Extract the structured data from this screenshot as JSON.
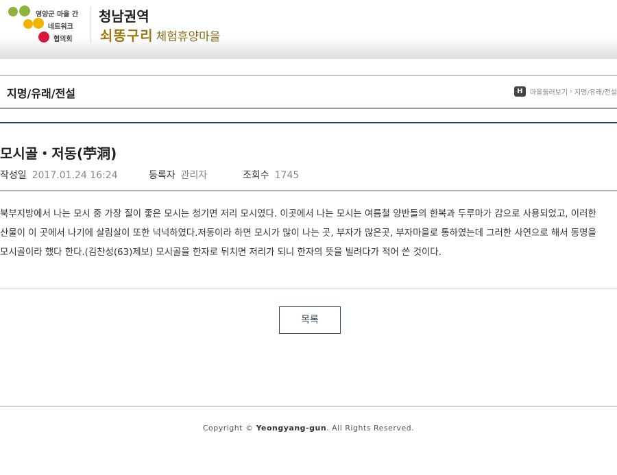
{
  "header": {
    "logo_lines": [
      "영양군 마을 간",
      "네트워크",
      "협의회"
    ],
    "site_line1": "청남권역",
    "brand": "쇠똥구리",
    "brand_sub": "체험휴양마을",
    "colors": {
      "logo_green": "#8db43e",
      "logo_yellow": "#f0b400",
      "logo_red": "#d6183a",
      "brand_gold": "#9a7a10"
    }
  },
  "titlebar": {
    "title": "지명/유래/전설",
    "breadcrumb_home": "H",
    "breadcrumb": [
      "마을둘러보기",
      "지명/유래/전설"
    ]
  },
  "article": {
    "title": "모시골・저동(苧洞)",
    "meta": {
      "date_label": "작성일",
      "date": "2017.01.24 16:24",
      "author_label": "등록자",
      "author": "관리자",
      "views_label": "조회수",
      "views": "1745"
    },
    "body": "북부지방에서 나는 모시 중 가장 질이 좋은 모시는 청기면 저리 모시였다. 이곳에서 나는 모시는 여름철 양반들의 한복과 두루마가 감으로 사용되었고, 이러한 산물이 이 곳에서 나기에 살림살이 또한 넉넉하였다.저동이라 하면 모시가 많이 나는 곳, 부자가 많은곳, 부자마을로 통하였는데 그러한 사연으로 해서 동명을 모시골이라 했다 한다.(김찬성(63)제보) 모시골을 한자로 뒤치면 저리가 되니 한자의 뜻을 빌려다가 적어 쓴 것이다."
  },
  "actions": {
    "list_label": "목록"
  },
  "footer": {
    "prefix": "Copyright ©",
    "brand": "Yeongyang-gun",
    "suffix": ". All Rights Reserved."
  }
}
